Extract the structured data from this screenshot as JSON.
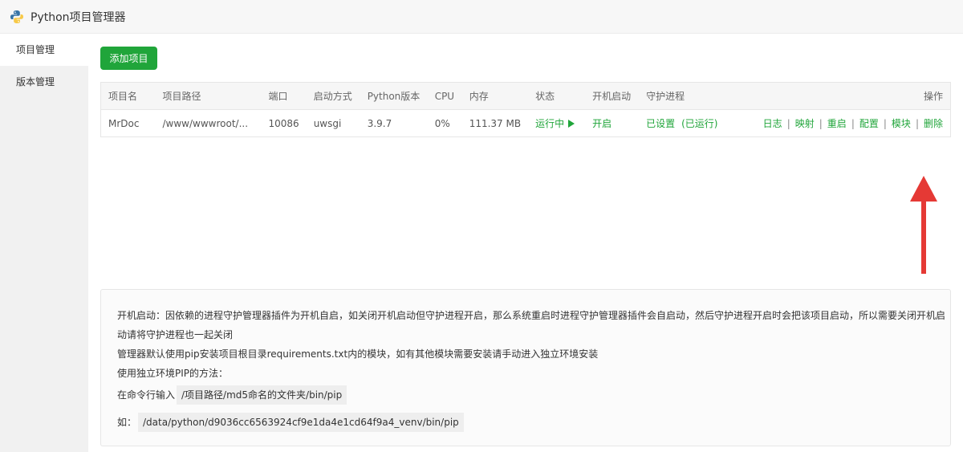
{
  "window": {
    "title": "Python项目管理器",
    "logo_icon": "python-logo-icon"
  },
  "sidebar": {
    "items": [
      {
        "label": "项目管理",
        "active": true
      },
      {
        "label": "版本管理",
        "active": false
      }
    ]
  },
  "toolbar": {
    "add_label": "添加项目"
  },
  "table": {
    "headers": [
      "项目名",
      "项目路径",
      "端口",
      "启动方式",
      "Python版本",
      "CPU",
      "内存",
      "状态",
      "开机启动",
      "守护进程",
      "操作"
    ],
    "rows": [
      {
        "name": "MrDoc",
        "path": "/www/wwwroot/...",
        "port": "10086",
        "start_mode": "uwsgi",
        "python_version": "3.9.7",
        "cpu": "0%",
        "memory": "111.37 MB",
        "status": "运行中",
        "autostart": "开启",
        "guard": "已设置",
        "guard_note": "(已运行)",
        "ops": [
          "日志",
          "映射",
          "重启",
          "配置",
          "模块",
          "删除"
        ],
        "separator": "|"
      }
    ]
  },
  "info": {
    "line1": "开机启动：因依赖的进程守护管理器插件为开机自启，如关闭开机启动但守护进程开启，那么系统重启时进程守护管理器插件会自启动，然后守护进程开启时会把该项目启动，所以需要关闭开机启动请将守护进程也一起关闭",
    "line2": "管理器默认使用pip安装项目根目录requirements.txt内的模块，如有其他模块需要安装请手动进入独立环境安装",
    "line3": "使用独立环境PIP的方法：",
    "line4_label": "在命令行输入",
    "line4_code": "/项目路径/md5命名的文件夹/bin/pip",
    "line5_label": "如：",
    "line5_code": "/data/python/d9036cc6563924cf9e1da4e1cd64f9a4_venv/bin/pip"
  },
  "colors": {
    "accent": "#20a53a",
    "arrow": "#e53935"
  }
}
